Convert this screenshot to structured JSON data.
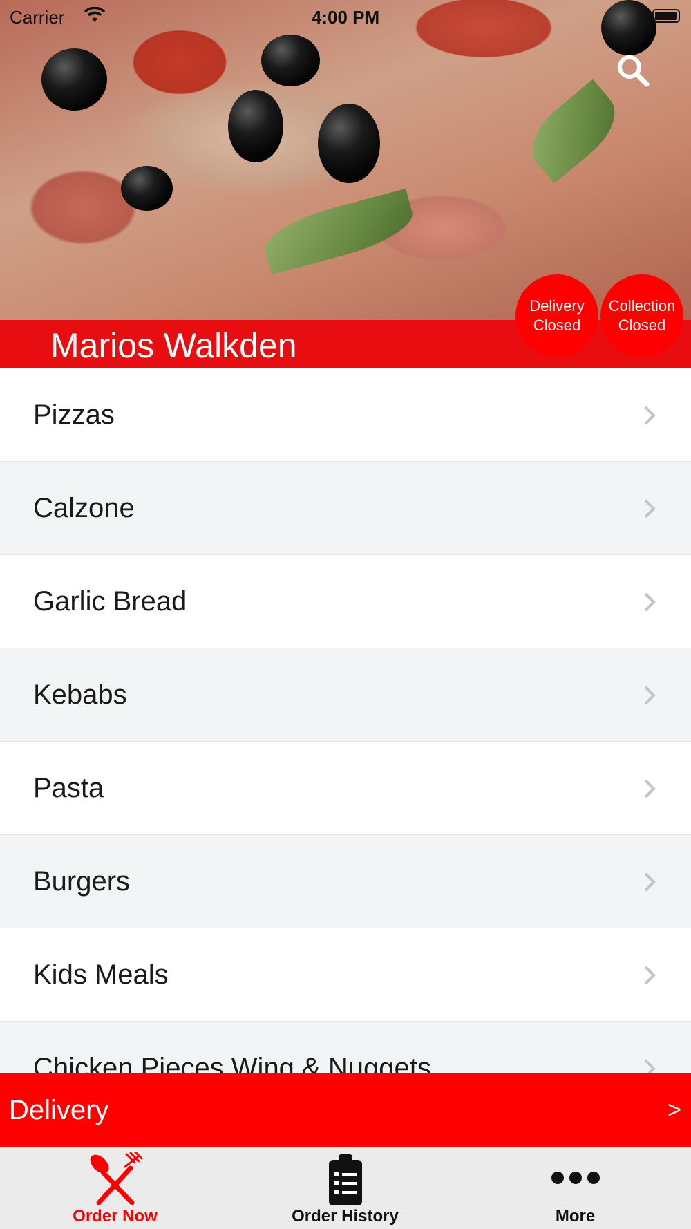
{
  "status_bar": {
    "carrier": "Carrier",
    "time": "4:00 PM"
  },
  "header": {
    "restaurant_name": "Marios Walkden",
    "delivery_status": {
      "line1": "Delivery",
      "line2": "Closed"
    },
    "collection_status": {
      "line1": "Collection",
      "line2": "Closed"
    },
    "search_icon": "search-icon"
  },
  "menu": {
    "items": [
      {
        "label": "Pizzas"
      },
      {
        "label": "Calzone"
      },
      {
        "label": "Garlic Bread"
      },
      {
        "label": "Kebabs"
      },
      {
        "label": "Pasta"
      },
      {
        "label": "Burgers"
      },
      {
        "label": "Kids Meals"
      },
      {
        "label": "Chicken Pieces Wing & Nuggets"
      }
    ]
  },
  "order_mode": {
    "label": "Delivery",
    "arrow": ">"
  },
  "tabs": [
    {
      "label": "Order Now",
      "icon": "fork-knife-icon",
      "active": true
    },
    {
      "label": "Order History",
      "icon": "clipboard-list-icon",
      "active": false
    },
    {
      "label": "More",
      "icon": "more-dots-icon",
      "active": false
    }
  ],
  "colors": {
    "accent": "#ff0000",
    "title_bar": "#e80d10",
    "row_alt": "#f3f4f6",
    "tab_bar": "#ebebeb"
  }
}
